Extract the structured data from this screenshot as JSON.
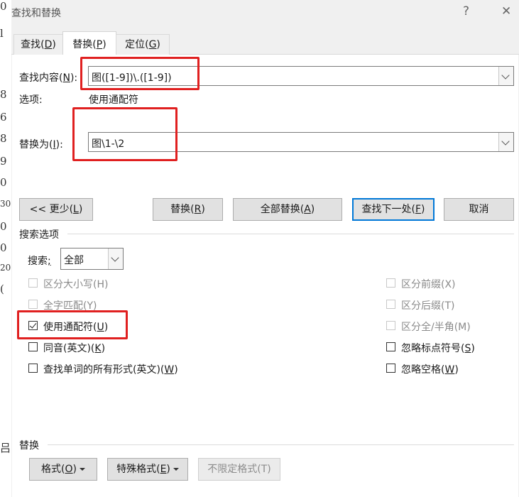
{
  "background_glyphs": [
    "0",
    "l",
    "8",
    "6",
    "8",
    "9",
    "0",
    "30",
    "0",
    "0",
    "20",
    "(",
    "吕"
  ],
  "title": "查找和替换",
  "title_buttons": {
    "help": "?",
    "close": "✕"
  },
  "tabs": [
    {
      "label": "查找(",
      "key": "D",
      "suffix": ")"
    },
    {
      "label": "替换(",
      "key": "P",
      "suffix": ")"
    },
    {
      "label": "定位(",
      "key": "G",
      "suffix": ")"
    }
  ],
  "find": {
    "label": "查找内容(",
    "key": "N",
    "suffix": "):",
    "value": "图([1-9])\\.([1-9])"
  },
  "options": {
    "label": "选项:",
    "value": "使用通配符"
  },
  "replace": {
    "label": "替换为(",
    "key": "I",
    "suffix": "):",
    "value": "图\\1-\\2"
  },
  "buttons": {
    "less": {
      "pre": "<< 更少(",
      "key": "L",
      "suffix": ")"
    },
    "replace": {
      "pre": "替换(",
      "key": "R",
      "suffix": ")"
    },
    "replace_all": {
      "pre": "全部替换(",
      "key": "A",
      "suffix": ")"
    },
    "find_next": {
      "pre": "查找下一处(",
      "key": "F",
      "suffix": ")"
    },
    "cancel": "取消"
  },
  "search_options": {
    "title": "搜索选项",
    "search_label": "搜索",
    "search_key": ";",
    "search_value": "全部"
  },
  "checkboxes_left": [
    {
      "label": "区分大小写(H)",
      "checked": false,
      "disabled": true
    },
    {
      "label": "全字匹配(Y)",
      "checked": false,
      "disabled": true
    },
    {
      "label": "使用通配符(",
      "key": "U",
      "suffix": ")",
      "checked": true,
      "disabled": false
    },
    {
      "label": "同音(英文)(",
      "key": "K",
      "suffix": ")",
      "checked": false,
      "disabled": false
    },
    {
      "label": "查找单词的所有形式(英文)(",
      "key": "W",
      "suffix": ")",
      "checked": false,
      "disabled": false
    }
  ],
  "checkboxes_right": [
    {
      "label": "区分前缀(X)",
      "checked": false,
      "disabled": true
    },
    {
      "label": "区分后缀(T)",
      "checked": false,
      "disabled": true
    },
    {
      "label": "区分全/半角(M)",
      "checked": false,
      "disabled": true
    },
    {
      "label": "忽略标点符号(",
      "key": "S",
      "suffix": ")",
      "checked": false,
      "disabled": false
    },
    {
      "label": "忽略空格(",
      "key": "W",
      "suffix": ")",
      "checked": false,
      "disabled": false
    }
  ],
  "replace_section": {
    "title": "替换",
    "format": {
      "pre": "格式(",
      "key": "O",
      "suffix": ")"
    },
    "special": {
      "pre": "特殊格式(",
      "key": "E",
      "suffix": ")"
    },
    "no_format": "不限定格式(T)"
  },
  "colors": {
    "highlight": "#e02020",
    "accent": "#0078d7"
  }
}
